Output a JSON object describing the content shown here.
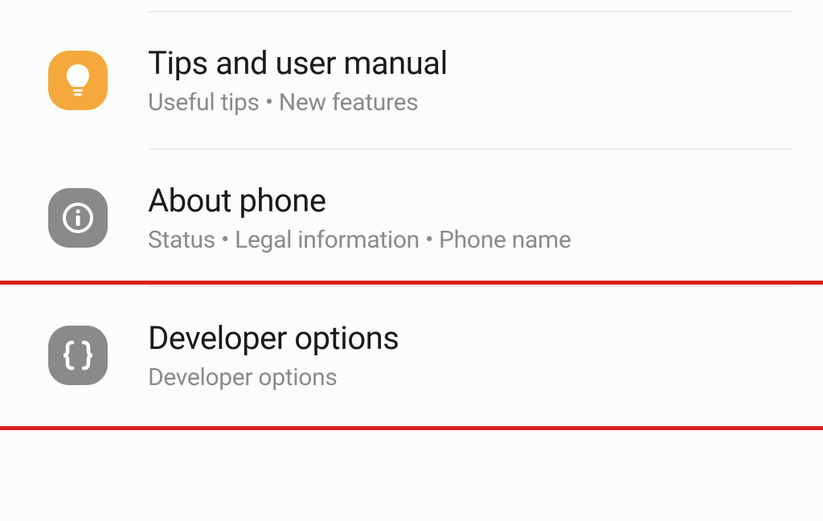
{
  "settings": {
    "items": [
      {
        "title": "Tips and user manual",
        "subtitle": "Useful tips  •  New features"
      },
      {
        "title": "About phone",
        "subtitle": "Status  •  Legal information  •  Phone name"
      },
      {
        "title": "Developer options",
        "subtitle": "Developer options"
      }
    ]
  }
}
